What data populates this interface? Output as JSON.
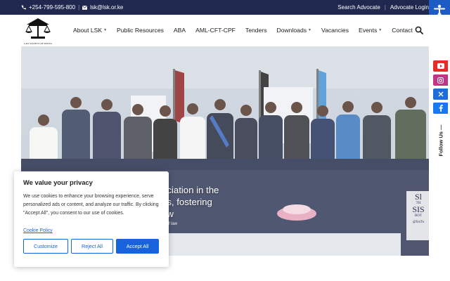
{
  "topbar": {
    "phone_icon": "phone-icon",
    "phone": "+254-799-595-800",
    "email_icon": "envelope-icon",
    "email": "lsk@lsk.or.ke",
    "links": [
      "Search Advocate",
      "Advocate Login"
    ]
  },
  "accessibility": {
    "icon": "accessibility-person-icon"
  },
  "logo": {
    "caption": "LAW SOCIETY OF KENYA"
  },
  "nav": {
    "items": [
      {
        "label": "About LSK",
        "has_dropdown": true
      },
      {
        "label": "Public Resources",
        "has_dropdown": false
      },
      {
        "label": "ABA",
        "has_dropdown": false
      },
      {
        "label": "AML-CFT-CPF",
        "has_dropdown": false
      },
      {
        "label": "Tenders",
        "has_dropdown": false
      },
      {
        "label": "Downloads",
        "has_dropdown": true
      },
      {
        "label": "Vacancies",
        "has_dropdown": false
      },
      {
        "label": "Events",
        "has_dropdown": true
      },
      {
        "label": "Contact",
        "has_dropdown": false
      }
    ],
    "search_icon": "search-icon"
  },
  "hero": {
    "lines": [
      "ociation in the",
      "es, fostering",
      "aw"
    ],
    "sub": "le of law",
    "banner_lines": [
      "Sl",
      "TH",
      "SIS",
      "HOT",
      "@SisTu"
    ]
  },
  "social": {
    "items": [
      {
        "name": "youtube-icon",
        "color": "#e52d27"
      },
      {
        "name": "instagram-icon",
        "color": "#c13584"
      },
      {
        "name": "x-twitter-icon",
        "color": "#1d6cd9"
      },
      {
        "name": "facebook-icon",
        "color": "#1877f2"
      }
    ],
    "follow_label": "Follow Us —"
  },
  "consent": {
    "title": "We value your privacy",
    "body": "We use cookies to enhance your browsing experience, serve personalized ads or content, and analyze our traffic. By clicking \"Accept All\", you consent to our use of cookies.",
    "policy_link": "Cookie Policy",
    "buttons": {
      "customize": "Customize",
      "reject": "Reject All",
      "accept": "Accept All"
    },
    "accent": "#1863dc"
  },
  "colors": {
    "topbar": "#202850",
    "accent_blue": "#1d5cc4"
  }
}
